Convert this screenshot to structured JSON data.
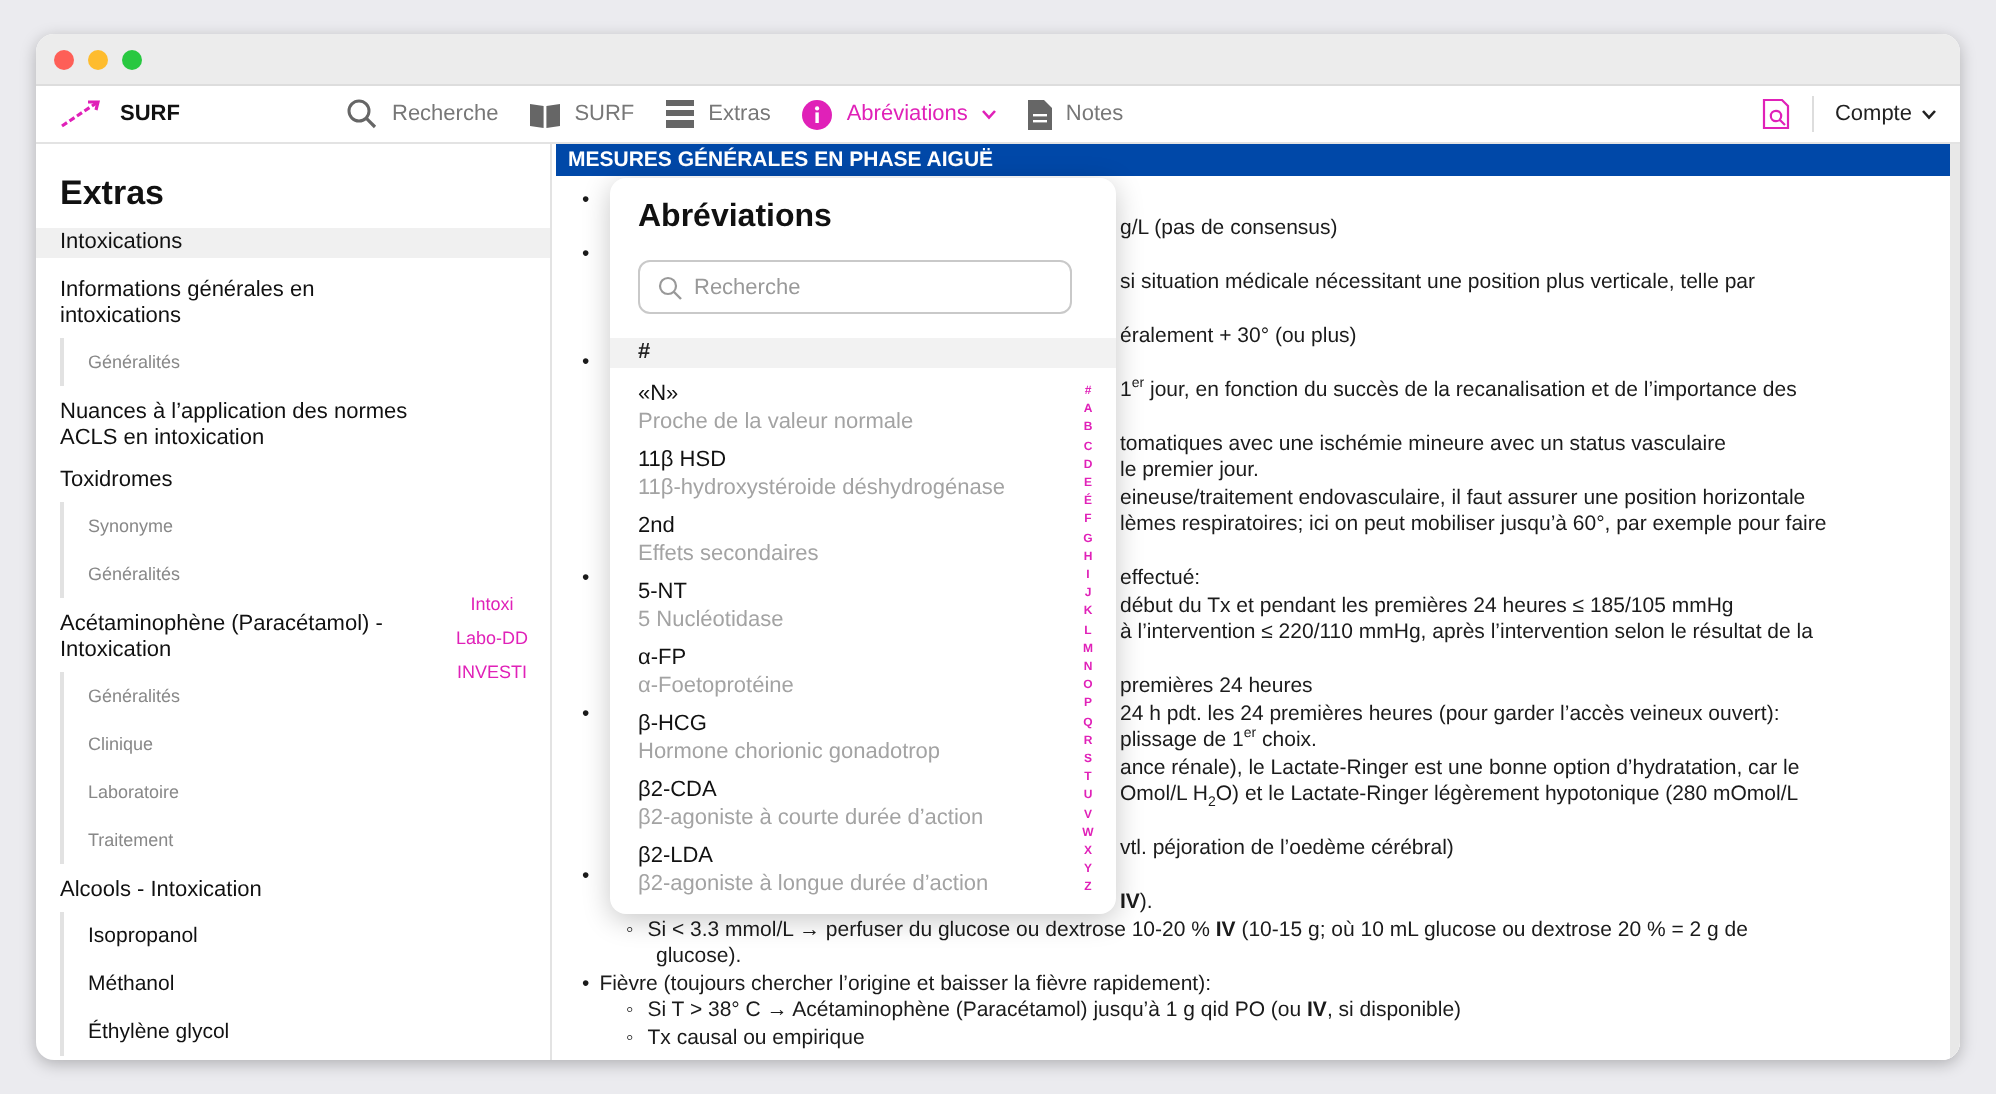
{
  "nav": {
    "brand": "SURF",
    "items": [
      {
        "kind": "search",
        "label": "Recherche",
        "selected": false
      },
      {
        "kind": "book",
        "label": "SURF",
        "selected": false
      },
      {
        "kind": "stack",
        "label": "Extras",
        "selected": false
      },
      {
        "kind": "info",
        "label": "Abréviations",
        "selected": true
      },
      {
        "kind": "doc",
        "label": "Notes",
        "selected": false
      }
    ],
    "account": "Compte"
  },
  "sidebar": {
    "title": "Extras",
    "items": [
      {
        "label": "Intoxications",
        "selected": true
      },
      {
        "label": "Informations générales en intoxications",
        "selected": false,
        "children": [
          {
            "label": "Généralités",
            "kind": "section"
          }
        ]
      },
      {
        "label": "Nuances à l’application des normes ACLS en intoxication",
        "selected": false
      },
      {
        "label": "Toxidromes",
        "selected": false,
        "children": [
          {
            "label": "Synonyme",
            "kind": "section"
          },
          {
            "label": "Généralités",
            "kind": "section"
          }
        ]
      },
      {
        "label": "Acétaminophène (Paracétamol) - Intoxication",
        "selected": false,
        "children": [
          {
            "label": "Généralités",
            "kind": "section"
          },
          {
            "label": "Clinique",
            "kind": "section"
          },
          {
            "label": "Laboratoire",
            "kind": "section"
          },
          {
            "label": "Traitement",
            "kind": "section"
          }
        ]
      },
      {
        "label": "Alcools - Intoxication",
        "selected": false,
        "children": [
          {
            "label": "Isopropanol",
            "kind": "article"
          },
          {
            "label": "Méthanol",
            "kind": "article"
          },
          {
            "label": "Éthylène glycol",
            "kind": "article"
          }
        ]
      }
    ],
    "quick_links": [
      "Intoxi",
      "Labo-DD",
      "INVESTI"
    ]
  },
  "main": {
    "header": "MESURES GÉNÉRALES EN PHASE AIGUË",
    "blocks": [
      {
        "lines": [
          {
            "kind": "split",
            "marker": "•"
          },
          {
            "kind": "split",
            "text": "g/L (pas de consensus)"
          },
          {
            "kind": "split",
            "marker": "•"
          },
          {
            "kind": "split",
            "text": "si situation médicale nécessitant une position plus verticale, telle par"
          }
        ]
      },
      {
        "lines": [
          {
            "kind": "split",
            "text": "éralement + 30° (ou plus)"
          },
          {
            "kind": "split",
            "marker": "•"
          },
          {
            "kind": "split",
            "text": "1$^{er}$ jour, en fonction du succès de la recanalisation et de l’importance des"
          }
        ]
      },
      {
        "lines": [
          {
            "kind": "split",
            "text": "tomatiques avec une ischémie mineure avec un status vasculaire"
          },
          {
            "kind": "split",
            "text": "le premier jour."
          },
          {
            "kind": "split",
            "text": "eineuse/traitement endovasculaire, il faut assurer une position horizontale"
          },
          {
            "kind": "split",
            "text": "lèmes respiratoires; ici on peut mobiliser jusqu’à 60°, par exemple pour faire"
          }
        ]
      },
      {
        "lines": [
          {
            "kind": "split",
            "marker": "•",
            "text": "effectué:"
          },
          {
            "kind": "split",
            "text": "début du Tx et pendant les premières 24 heures ≤ 185/105 mmHg"
          },
          {
            "kind": "split",
            "text": "à l’intervention ≤ 220/110 mmHg, après l’intervention selon le résultat de la"
          }
        ]
      },
      {
        "lines": [
          {
            "kind": "split",
            "text": "premières 24 heures"
          },
          {
            "kind": "split",
            "marker": "•",
            "text": "24 h pdt. les 24 premières heures (pour garder l’accès veineux ouvert):"
          },
          {
            "kind": "split",
            "text": "plissage de 1$^{er}$ choix."
          },
          {
            "kind": "split",
            "text": "ance rénale), le Lactate-Ringer est une bonne option d’hydratation, car le"
          },
          {
            "kind": "split",
            "text": "Omol/L H$_{2}$O) et le Lactate-Ringer légèrement hypotonique (280 mOmol/L"
          }
        ]
      },
      {
        "lines": [
          {
            "kind": "split",
            "text": "vtl. péjoration de l’oedème cérébral)"
          },
          {
            "kind": "split",
            "marker": "•"
          },
          {
            "kind": "split",
            "text": "**IV**)."
          },
          {
            "kind": "sub",
            "marker": "◦",
            "text": "Si < 3.3 mmol/L → perfuser du glucose ou dextrose 10-20 % **IV** (10-15 g; où 10 mL glucose ou dextrose 20 % = 2 g de"
          },
          {
            "kind": "cont",
            "text": "glucose)."
          },
          {
            "kind": "bullet",
            "marker": "•",
            "text": "Fièvre (toujours chercher l’origine et baisser la fièvre rapidement):"
          },
          {
            "kind": "sub",
            "marker": "◦",
            "text": "Si T > 38° C → Acétaminophène (Paracétamol) jusqu’à 1 g qid PO (ou **IV**, si disponible)"
          },
          {
            "kind": "sub",
            "marker": "◦",
            "text": "Tx causal ou empirique"
          }
        ]
      }
    ]
  },
  "popup": {
    "title": "Abréviations",
    "search": {
      "placeholder": "Recherche"
    },
    "section": "#",
    "entries": [
      {
        "abbr": "«N»",
        "definition": "Proche de la valeur normale"
      },
      {
        "abbr": "11β HSD",
        "definition": "11β-hydroxystéroide déshydrogénase"
      },
      {
        "abbr": "2nd",
        "definition": "Effets secondaires"
      },
      {
        "abbr": "5-NT",
        "definition": "5 Nucléotidase"
      },
      {
        "abbr": "α-FP",
        "definition": "α-Foetoprotéine"
      },
      {
        "abbr": "β-HCG",
        "definition": "Hormone chorionic gonadotrop"
      },
      {
        "abbr": "β2-CDA",
        "definition": "β2-agoniste à courte durée d’action"
      },
      {
        "abbr": "β2-LDA",
        "definition": "β2-agoniste à longue durée d’action"
      }
    ],
    "index": [
      "#",
      "A",
      "B",
      "C",
      "D",
      "E",
      "É",
      "F",
      "G",
      "H",
      "I",
      "J",
      "K",
      "L",
      "M",
      "N",
      "O",
      "P",
      "Q",
      "R",
      "S",
      "T",
      "U",
      "V",
      "W",
      "X",
      "Y",
      "Z"
    ]
  }
}
